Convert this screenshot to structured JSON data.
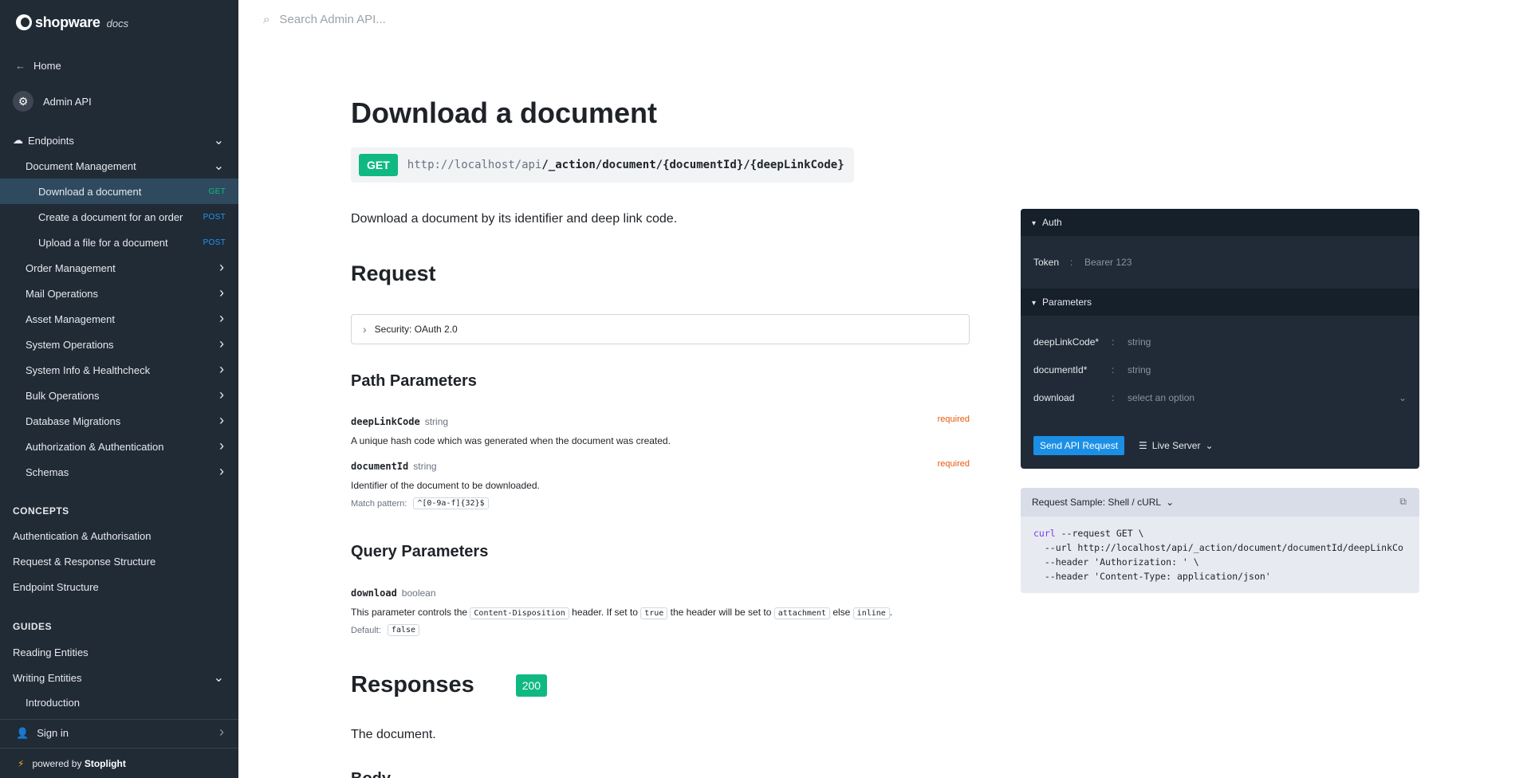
{
  "brand": {
    "name": "shopware",
    "suffix": "docs"
  },
  "search": {
    "placeholder": "Search Admin API..."
  },
  "sidebar": {
    "home": "Home",
    "api_name": "Admin API",
    "endpoints_label": "Endpoints",
    "group_open": "Document Management",
    "sub_items": [
      {
        "label": "Download a document",
        "method": "GET"
      },
      {
        "label": "Create a document for an order",
        "method": "POST"
      },
      {
        "label": "Upload a file for a document",
        "method": "POST"
      }
    ],
    "groups": [
      "Order Management",
      "Mail Operations",
      "Asset Management",
      "System Operations",
      "System Info & Healthcheck",
      "Bulk Operations",
      "Database Migrations",
      "Authorization & Authentication",
      "Schemas"
    ],
    "concepts_label": "CONCEPTS",
    "concepts": [
      "Authentication & Authorisation",
      "Request & Response Structure",
      "Endpoint Structure"
    ],
    "guides_label": "GUIDES",
    "guides": [
      "Reading Entities",
      "Writing Entities"
    ],
    "guide_sub": "Introduction",
    "signin": "Sign in",
    "powered_prefix": "powered by",
    "powered_brand": "Stoplight"
  },
  "page": {
    "title": "Download a document",
    "method": "GET",
    "url_base": "http://localhost/api",
    "url_path": "/_action/document/{documentId}/{deepLinkCode}",
    "description": "Download a document by its identifier and deep link code.",
    "request_heading": "Request",
    "security": "Security: OAuth 2.0",
    "path_heading": "Path Parameters",
    "path_params": [
      {
        "name": "deepLinkCode",
        "type": "string",
        "required": "required",
        "desc": "A unique hash code which was generated when the document was created."
      },
      {
        "name": "documentId",
        "type": "string",
        "required": "required",
        "desc": "Identifier of the document to be downloaded.",
        "pattern_label": "Match pattern:",
        "pattern": "^[0-9a-f]{32}$"
      }
    ],
    "query_heading": "Query Parameters",
    "query_param": {
      "name": "download",
      "type": "boolean",
      "desc_1": "This parameter controls the",
      "code_1": "Content-Disposition",
      "desc_2": "header. If set to",
      "code_2": "true",
      "desc_3": "the header will be set to",
      "code_3": "attachment",
      "desc_4": "else",
      "code_4": "inline",
      "desc_5": ".",
      "default_label": "Default:",
      "default": "false"
    },
    "responses_heading": "Responses",
    "response_code": "200",
    "response_desc": "The document.",
    "cut_heading": "Body"
  },
  "try_it": {
    "auth_label": "Auth",
    "token_label": "Token",
    "token_value": "Bearer 123",
    "params_label": "Parameters",
    "params": [
      {
        "label": "deepLinkCode*",
        "value": "string"
      },
      {
        "label": "documentId*",
        "value": "string"
      },
      {
        "label": "download",
        "value": "select an option"
      }
    ],
    "send_label": "Send API Request",
    "server_label": "Live Server"
  },
  "sample": {
    "title": "Request Sample: Shell / cURL",
    "lines": [
      "curl --request GET \\",
      "  --url http://localhost/api/_action/document/documentId/deepLinkCo",
      "  --header 'Authorization: ' \\",
      "  --header 'Content-Type: application/json'"
    ]
  },
  "colors": {
    "sidebar_bg": "#212b36",
    "active_bg": "#2f4a5e",
    "get_green": "#10b981",
    "post_blue": "#2196f3",
    "required_orange": "#e8590c",
    "send_blue": "#1b8fe6"
  }
}
